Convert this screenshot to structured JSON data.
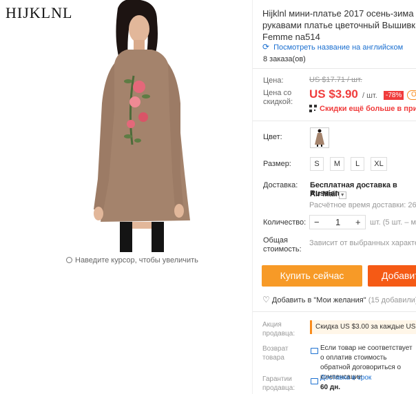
{
  "brand": {
    "logo_text": "HIJKLNL"
  },
  "image": {
    "zoom_hint": "Наведите курсор, чтобы увеличить"
  },
  "product": {
    "title": "Hijklnl мини-платье 2017 осень-зима Д рукавами платье цветочный Вышивка Femme na514",
    "translate_link": "Посмотреть название на английском",
    "orders": "8 заказа(ов)"
  },
  "price": {
    "label_price": "Цена:",
    "old_price": "US $17.71 / шт.",
    "label_discount": "Цена со скидкой:",
    "current": "US $3.90",
    "unit": "/ шт.",
    "discount_badge": "-78%",
    "coupon_badge": "O",
    "app_promo": "Скидки ещё больше в прилож"
  },
  "options": {
    "color_label": "Цвет:",
    "size_label": "Размер:",
    "sizes": [
      "S",
      "M",
      "L",
      "XL"
    ]
  },
  "shipping": {
    "label": "Доставка:",
    "method": "Бесплатная доставка в Russian",
    "carrier": "Air Mail",
    "estimate": "Расчётное время доставки: 26-48"
  },
  "quantity": {
    "label": "Количество:",
    "value": "1",
    "minus": "−",
    "plus": "+",
    "note": "шт. (5 шт. – ма"
  },
  "total": {
    "label": "Общая стоимость:",
    "note": "Зависит от выбранных характери"
  },
  "actions": {
    "buy_now": "Купить сейчас",
    "add_to_cart": "Добавит",
    "wishlist": "Добавить в \"Мои желания\"",
    "wishlist_count": "(15 добавили)"
  },
  "seller_info": {
    "promo_label": "Акция продавца:",
    "promo_text": "Скидка US $3.00 за каждые US $",
    "return_label": "Возврат товара",
    "return_text": "Если товар не соответствует о оплатив стоимость обратной договориться о компенсации",
    "guarantee_label": "Гарантии продавца:",
    "guarantee_text": "Доставка в срок",
    "guarantee_days": "60 дн."
  }
}
